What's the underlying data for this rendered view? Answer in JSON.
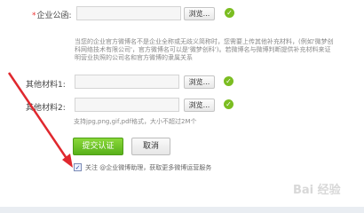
{
  "form": {
    "company_letter": {
      "required_mark": "*",
      "label": "企业公函:",
      "browse_label": "浏览..."
    },
    "note_text": "当您的企业官方微博名不是企业全称或无歧义简称时，您需要上传其他补充材料，(例如'微梦创科网络技术有限公司'，官方微博名可以是'微梦创科')。若微博名与微博判断提供补充材料来证明营业执照的公司名和官方微博的隶属关系",
    "material1": {
      "label": "其他材料1:",
      "browse_label": "浏览..."
    },
    "material2": {
      "label": "其他材料2:",
      "browse_label": "浏览..."
    },
    "file_hint": "支持jpg,png,gif,pdf格式，大小不超过2M个",
    "submit_label": "提交认证",
    "cancel_label": "取消",
    "follow_text": "关注 @企业微博助理，获取更多微博运营服务",
    "follow_checked": true
  },
  "watermark": {
    "text": "Bai 经验"
  },
  "colors": {
    "accent_green": "#66c12a",
    "arrow_red": "#e0282e"
  }
}
